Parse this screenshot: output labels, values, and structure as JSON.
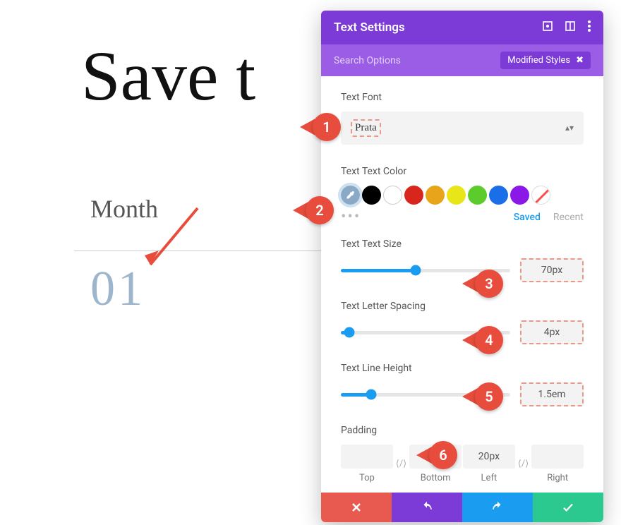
{
  "background": {
    "title": "Save t",
    "month_label": "Month",
    "number": "01"
  },
  "panel": {
    "title": "Text Settings",
    "search_placeholder": "Search Options",
    "modified_btn": "Modified Styles",
    "sections": {
      "font": {
        "label": "Text Font",
        "value": "Prata"
      },
      "color": {
        "label": "Text Text Color",
        "saved": "Saved",
        "recent": "Recent"
      },
      "size": {
        "label": "Text Text Size",
        "value": "70px",
        "percent": 44
      },
      "spacing": {
        "label": "Text Letter Spacing",
        "value": "4px",
        "percent": 5
      },
      "lineheight": {
        "label": "Text Line Height",
        "value": "1.5em",
        "percent": 18
      },
      "padding": {
        "label": "Padding",
        "top": {
          "label": "Top",
          "value": ""
        },
        "bottom": {
          "label": "Bottom",
          "value": ""
        },
        "left": {
          "label": "Left",
          "value": "20px"
        },
        "right": {
          "label": "Right",
          "value": ""
        }
      }
    }
  },
  "swatch_colors": [
    "#000000",
    "#ffffff",
    "#d8261c",
    "#e8a519",
    "#e8e619",
    "#5ccc2c",
    "#1a6ee8",
    "#8a19e8"
  ],
  "callouts": [
    "1",
    "2",
    "3",
    "4",
    "5",
    "6"
  ]
}
